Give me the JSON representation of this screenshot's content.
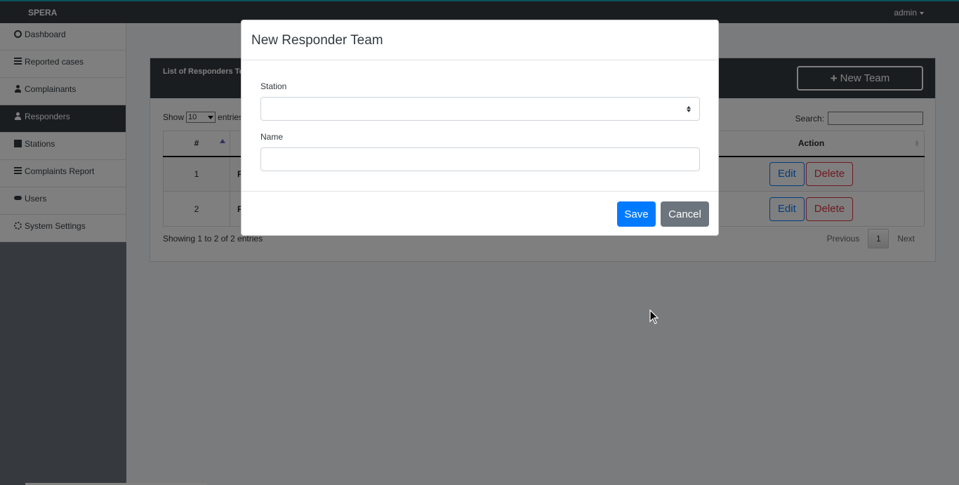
{
  "topbar": {
    "brand": "SPERA",
    "user": "admin"
  },
  "sidebar": {
    "items": [
      {
        "label": "Dashboard",
        "icon": "dashboard-icon"
      },
      {
        "label": "Reported cases",
        "icon": "list-icon"
      },
      {
        "label": "Complainants",
        "icon": "person-icon"
      },
      {
        "label": "Responders",
        "icon": "user-cog-icon",
        "active": true
      },
      {
        "label": "Stations",
        "icon": "building-icon"
      },
      {
        "label": "Complaints Report",
        "icon": "table-icon"
      },
      {
        "label": "Users",
        "icon": "users-icon"
      },
      {
        "label": "System Settings",
        "icon": "cogs-icon"
      }
    ]
  },
  "card": {
    "title": "List of Responders Te",
    "new_team_label": "New Team",
    "show_label": "Show",
    "length_value": "10",
    "entries_label": "entries",
    "search_label": "Search:",
    "columns": [
      "#",
      "Action"
    ],
    "rows": [
      {
        "num": "1",
        "name": "R",
        "edit": "Edit",
        "delete": "Delete"
      },
      {
        "num": "2",
        "name": "R",
        "edit": "Edit",
        "delete": "Delete"
      }
    ],
    "info": "Showing 1 to 2 of 2 entries",
    "pagination": {
      "previous": "Previous",
      "current": "1",
      "next": "Next"
    }
  },
  "modal": {
    "title": "New Responder Team",
    "station_label": "Station",
    "station_value": "",
    "name_label": "Name",
    "name_value": "",
    "save_label": "Save",
    "cancel_label": "Cancel"
  }
}
